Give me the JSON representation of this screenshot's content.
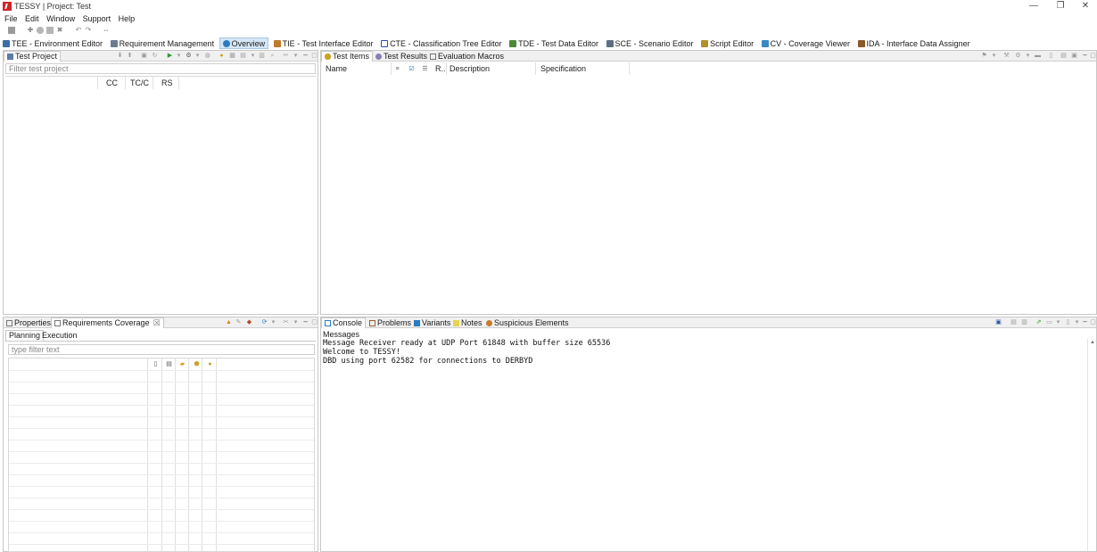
{
  "window": {
    "title": "TESSY | Project: Test",
    "minimize_glyph": "—",
    "restore_glyph": "❐",
    "close_glyph": "✕"
  },
  "menu": [
    "File",
    "Edit",
    "Window",
    "Support",
    "Help"
  ],
  "perspectives": [
    {
      "label": "TEE - Environment Editor",
      "icon": "tee-icon",
      "color": "#3a6ea5",
      "active": false
    },
    {
      "label": "Requirement Management",
      "icon": "requirement-icon",
      "color": "#6b7c8f",
      "active": false
    },
    {
      "label": "Overview",
      "icon": "overview-icon",
      "color": "#2b7bc0",
      "active": true
    },
    {
      "label": "TIE - Test Interface Editor",
      "icon": "tie-icon",
      "color": "#c07a2b",
      "active": false
    },
    {
      "label": "CTE - Classification Tree Editor",
      "icon": "cte-icon",
      "color": "#2b4fa5",
      "active": false
    },
    {
      "label": "TDE - Test Data Editor",
      "icon": "tde-icon",
      "color": "#4a8a3a",
      "active": false
    },
    {
      "label": "SCE - Scenario Editor",
      "icon": "sce-icon",
      "color": "#5d6f83",
      "active": false
    },
    {
      "label": "Script Editor",
      "icon": "script-icon",
      "color": "#b0902b",
      "active": false
    },
    {
      "label": "CV - Coverage Viewer",
      "icon": "cv-icon",
      "color": "#3a8ac0",
      "active": false
    },
    {
      "label": "IDA - Interface Data Assigner",
      "icon": "ida-icon",
      "color": "#8a5a2b",
      "active": false
    }
  ],
  "test_project": {
    "tab_label": "Test Project",
    "filter_placeholder": "Filter test project",
    "columns": [
      "CC",
      "TC/C",
      "RS"
    ]
  },
  "test_items": {
    "tabs": [
      "Test Items",
      "Test Results",
      "Evaluation Macros"
    ],
    "columns": [
      "Name",
      "R..",
      "Description",
      "Specification"
    ]
  },
  "properties_pane": {
    "tabs": [
      "Properties",
      "Requirements Coverage"
    ],
    "close_glyph": "☒",
    "subtabs": [
      "Planning",
      "Execution"
    ],
    "filter_placeholder": "type filter text"
  },
  "console_pane": {
    "tabs": [
      "Console",
      "Problems",
      "Variants",
      "Notes",
      "Suspicious Elements"
    ],
    "section_label": "Messages",
    "lines": [
      "Message Receiver ready at UDP Port 61848 with buffer size 65536",
      "Welcome to TESSY!",
      "DBD using port 62582 for connections to DERBYD"
    ]
  },
  "colors": {
    "accent": "#2b7bc0",
    "active_tab_bg": "#d5e6f6",
    "pane_border": "#c8c8c8",
    "header_bg": "#f0f0f0"
  }
}
